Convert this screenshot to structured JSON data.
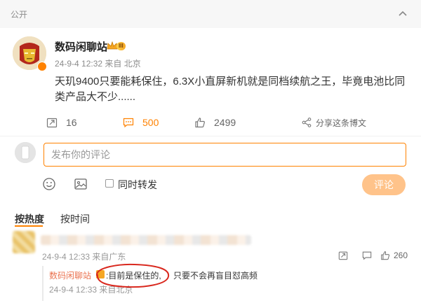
{
  "header": {
    "visibility": "公开"
  },
  "post": {
    "author": "数码闲聊站",
    "level_badge": "III",
    "meta": "24-9-4 12:32  来自 北京",
    "text": "天玑9400只要能耗保住，6.3X小直屏新机就是同档续航之王，毕竟电池比同类产品大不少......",
    "stats": {
      "reposts": "16",
      "comments": "500",
      "likes": "2499"
    },
    "share_label": "分享这条博文"
  },
  "compose": {
    "placeholder": "发布你的评论",
    "forward_label": "同时转发",
    "submit_label": "评论"
  },
  "sort": {
    "hot_label": "按热度",
    "time_label": "按时间"
  },
  "comment": {
    "meta": "24-9-4 12:33  来自广东",
    "likes": "260",
    "reply": {
      "author": "数码闲聊站",
      "text": ":目前是保住的,",
      "extra": "只要不会再盲目怼高频",
      "meta": "24-9-4 12:33  来自北京"
    }
  },
  "colors": {
    "accent": "#ff8200",
    "reply_author": "#eb7350",
    "annotation": "#d9281e"
  },
  "icons": [
    "chevron-up-icon",
    "repost-icon",
    "comment-icon",
    "like-icon",
    "share-icon",
    "emoji-icon",
    "image-icon",
    "verified-icon",
    "crown-icon"
  ]
}
